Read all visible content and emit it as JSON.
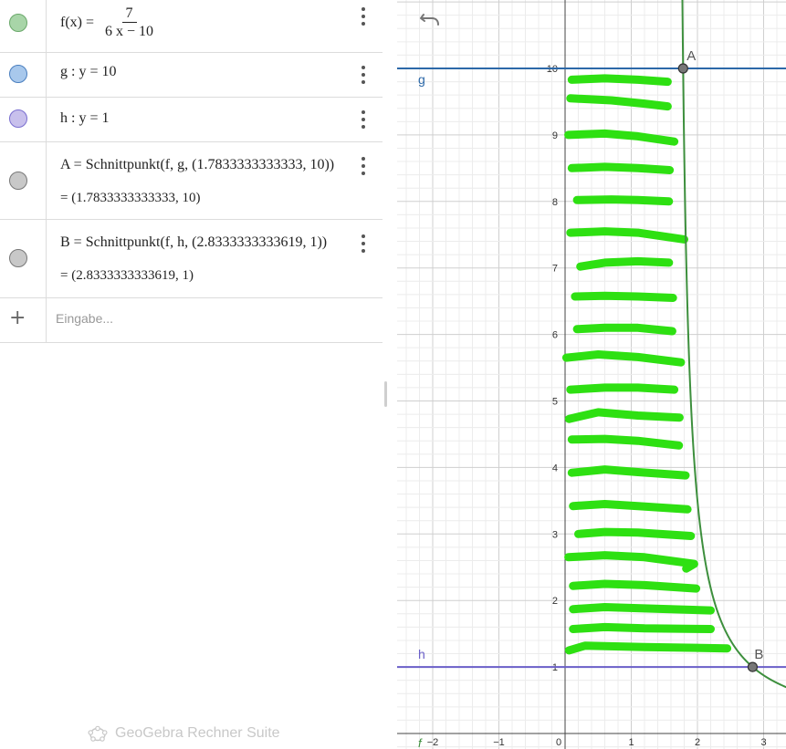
{
  "algebra": {
    "rows": [
      {
        "id": "f",
        "color": "#a8d5a8",
        "border": "#6aa86a",
        "lhs": "f(x)  =",
        "num": "7",
        "den": "6 x − 10"
      },
      {
        "id": "g",
        "color": "#a8c8ec",
        "border": "#4a7fbf",
        "text": "g : y  =  10"
      },
      {
        "id": "h",
        "color": "#c8c0ec",
        "border": "#7a6fd0",
        "text": "h : y  =  1"
      },
      {
        "id": "A",
        "color": "#c8c8c8",
        "border": "#777777",
        "text": "A  =  Schnittpunkt(f, g, (1.7833333333333, 10))",
        "result": "=  (1.7833333333333, 10)"
      },
      {
        "id": "B",
        "color": "#c8c8c8",
        "border": "#777777",
        "text": "B  =  Schnittpunkt(f, h, (2.8333333333619, 1))",
        "result": "=  (2.8333333333619, 1)"
      }
    ],
    "input_placeholder": "Eingabe..."
  },
  "footer": {
    "label": "GeoGebra Rechner Suite"
  },
  "graphics": {
    "x_ticks": [
      "−2",
      "−1",
      "0",
      "1",
      "2",
      "3"
    ],
    "y_ticks": [
      "1",
      "2",
      "3",
      "4",
      "5",
      "6",
      "7",
      "8",
      "9",
      "10"
    ],
    "labels": {
      "g": "g",
      "h": "h",
      "A": "A",
      "B": "B",
      "f": "f"
    },
    "colors": {
      "f": "#3d8f3d",
      "g": "#2c68a8",
      "h": "#6a5fc8",
      "highlight": "#2ee012"
    }
  }
}
